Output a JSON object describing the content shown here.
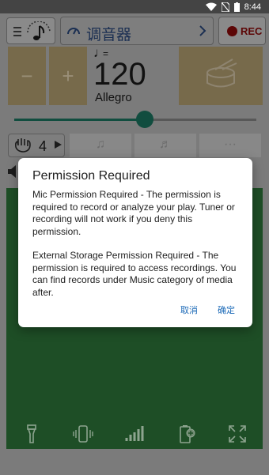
{
  "status_bar": {
    "time": "8:44"
  },
  "toolbar": {
    "tuner_label": "调音器",
    "rec_label": "REC"
  },
  "tempo": {
    "decrease_label": "−",
    "increase_label": "+",
    "note_eq": "=",
    "bpm": "120",
    "marking": "Allegro",
    "slider_fraction": 0.54
  },
  "beats": {
    "value": "4"
  },
  "subdivisions": {
    "more_label": "···"
  },
  "dialog": {
    "title": "Permission Required",
    "paragraph1": "Mic Permission Required - The permission is required to record or analyze your play. Tuner or recording will not work if you deny this permission.",
    "paragraph2": "External Storage Permission Required - The permission is required to access recordings. You can find records under Music category of media after.",
    "cancel_label": "取消",
    "ok_label": "确定"
  },
  "colors": {
    "accent_green": "#114d3f",
    "dialog_button": "#1e6bb8",
    "rec_red": "#5c0606"
  }
}
